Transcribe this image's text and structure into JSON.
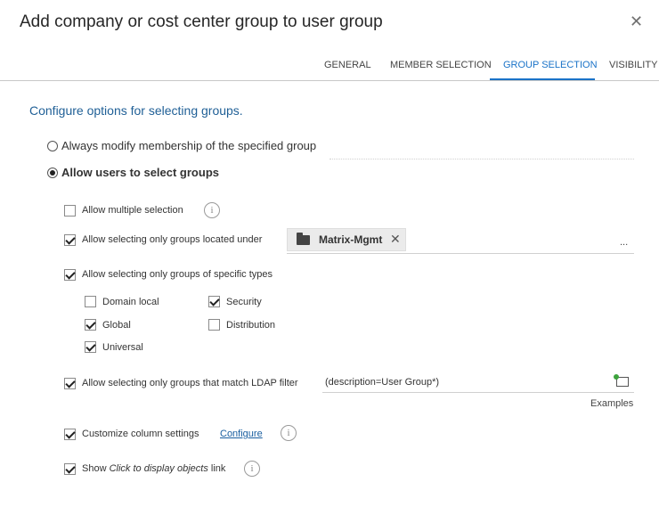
{
  "dialog": {
    "title": "Add company or cost center group to user group",
    "close_symbol": "✕"
  },
  "tabs": [
    {
      "label": "GENERAL",
      "active": false
    },
    {
      "label": "MEMBER SELECTION",
      "active": false
    },
    {
      "label": "GROUP SELECTION",
      "active": true
    },
    {
      "label": "VISIBILITY",
      "active": false
    }
  ],
  "section_title": "Configure options for selecting groups.",
  "radios": {
    "always_modify": {
      "label": "Always modify membership of the specified group",
      "selected": false
    },
    "allow_select": {
      "label": "Allow users to select groups",
      "selected": true
    }
  },
  "options": {
    "multiple_selection": {
      "label": "Allow multiple selection",
      "checked": false
    },
    "located_under": {
      "label": "Allow selecting only groups located under",
      "checked": true,
      "container": "Matrix-Mgmt",
      "chip_remove": "✕",
      "browse": "..."
    },
    "specific_types": {
      "label": "Allow selecting only groups of specific types",
      "checked": true,
      "types": {
        "domain_local": {
          "label": "Domain local",
          "checked": false
        },
        "security": {
          "label": "Security",
          "checked": true
        },
        "global": {
          "label": "Global",
          "checked": true
        },
        "distribution": {
          "label": "Distribution",
          "checked": false
        },
        "universal": {
          "label": "Universal",
          "checked": true
        }
      }
    },
    "ldap_filter": {
      "label": "Allow selecting only groups that match LDAP filter",
      "checked": true,
      "value": "(description=User Group*)",
      "examples": "Examples"
    },
    "customize_columns": {
      "label": "Customize column settings",
      "checked": true,
      "configure_link": "Configure"
    },
    "show_link": {
      "prefix": "Show ",
      "italic": "Click to display objects",
      "suffix": " link",
      "checked": true
    }
  },
  "info_symbol": "i",
  "colors": {
    "accent": "#1a73c8",
    "section_title": "#1f5f96",
    "link": "#1a5fa0"
  }
}
